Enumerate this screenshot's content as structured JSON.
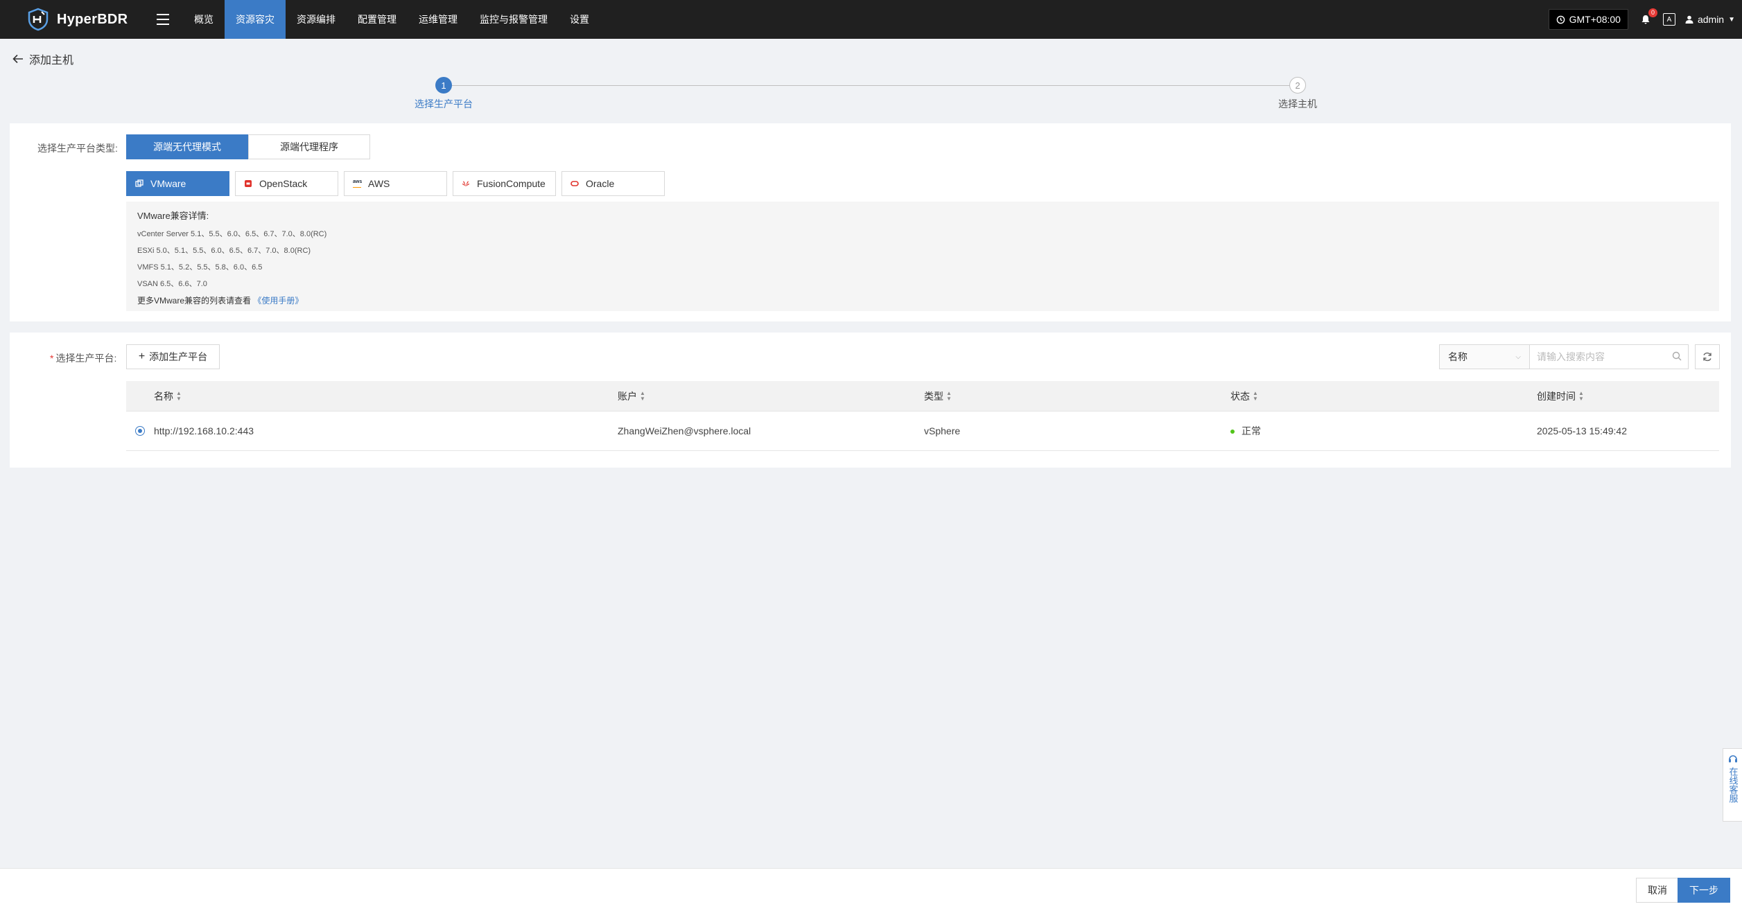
{
  "app": {
    "name": "HyperBDR"
  },
  "nav": {
    "items": [
      {
        "label": "概览",
        "active": false
      },
      {
        "label": "资源容灾",
        "active": true
      },
      {
        "label": "资源编排",
        "active": false
      },
      {
        "label": "配置管理",
        "active": false
      },
      {
        "label": "运维管理",
        "active": false
      },
      {
        "label": "监控与报警管理",
        "active": false
      },
      {
        "label": "设置",
        "active": false
      }
    ],
    "timezone": "GMT+08:00",
    "notification_count": "0",
    "user": "admin"
  },
  "page": {
    "back_label": "添加主机"
  },
  "steps": [
    {
      "num": "1",
      "label": "选择生产平台",
      "active": true
    },
    {
      "num": "2",
      "label": "选择主机",
      "active": false
    }
  ],
  "platform_type": {
    "label": "选择生产平台类型:",
    "modes": [
      "源端无代理模式",
      "源端代理程序"
    ],
    "selected_mode": "源端无代理模式",
    "platforms": [
      "VMware",
      "OpenStack",
      "AWS",
      "FusionCompute",
      "Oracle"
    ],
    "selected_platform": "VMware"
  },
  "compat": {
    "title": "VMware兼容详情:",
    "lines": [
      "vCenter Server 5.1、5.5、6.0、6.5、6.7、7.0、8.0(RC)",
      "ESXi 5.0、5.1、5.5、6.0、6.5、6.7、7.0、8.0(RC)",
      "VMFS 5.1、5.2、5.5、5.8、6.0、6.5",
      "VSAN 6.5、6.6、7.0"
    ],
    "more_text": "更多VMware兼容的列表请查看",
    "more_link": "《使用手册》"
  },
  "platform_select": {
    "label": "选择生产平台:",
    "add_button": "添加生产平台",
    "search_field": "名称",
    "search_placeholder": "请输入搜索内容",
    "columns": [
      "名称",
      "账户",
      "类型",
      "状态",
      "创建时间"
    ],
    "rows": [
      {
        "name": "http://192.168.10.2:443",
        "account": "ZhangWeiZhen@vsphere.local",
        "type": "vSphere",
        "status": "正常",
        "created": "2025-05-13 15:49:42",
        "selected": true
      }
    ]
  },
  "service": {
    "label": "在线客服"
  },
  "footer": {
    "cancel": "取消",
    "next": "下一步"
  },
  "colors": {
    "accent": "#3b7bc6",
    "topbar": "#202020",
    "status_ok": "#52c41a"
  }
}
